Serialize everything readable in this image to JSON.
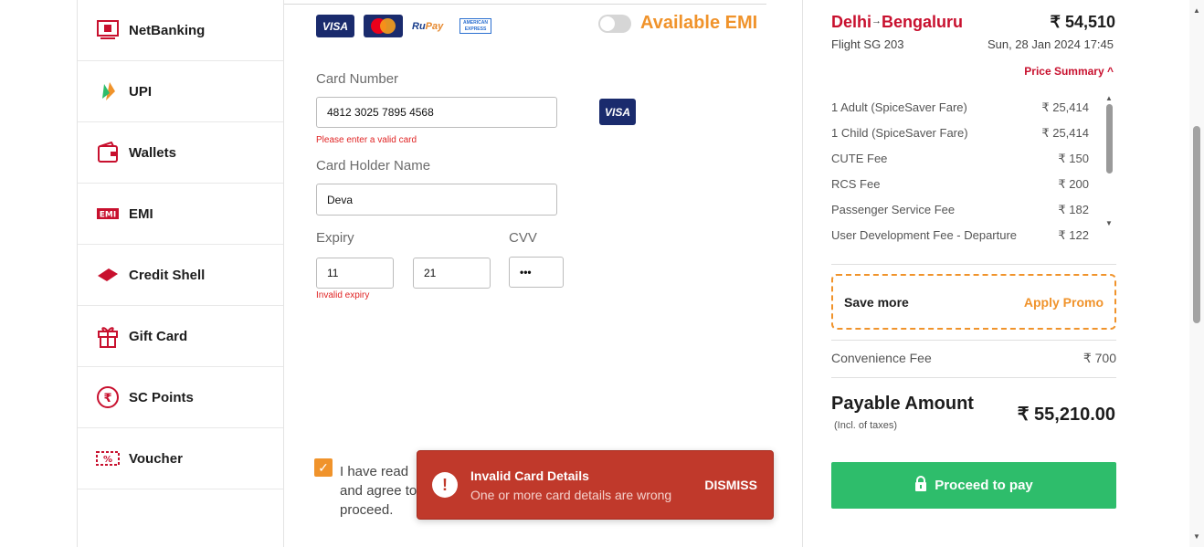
{
  "methods": [
    {
      "label": "NetBanking",
      "icon": "bank-icon"
    },
    {
      "label": "UPI",
      "icon": "upi-icon"
    },
    {
      "label": "Wallets",
      "icon": "wallet-icon"
    },
    {
      "label": "EMI",
      "icon": "emi-icon"
    },
    {
      "label": "Credit Shell",
      "icon": "credit-shell-icon"
    },
    {
      "label": "Gift Card",
      "icon": "gift-icon"
    },
    {
      "label": "SC Points",
      "icon": "rupee-icon"
    },
    {
      "label": "Voucher",
      "icon": "voucher-icon"
    }
  ],
  "card_logos": {
    "visa": "VISA",
    "mastercard": "MasterCard",
    "rupay_ru": "Ru",
    "rupay_pay": "Pay",
    "amex": "AMERICAN EXPRESS"
  },
  "emi": {
    "label": "Available EMI"
  },
  "form": {
    "card_number_label": "Card Number",
    "card_number_value": "4812 3025 7895 4568",
    "card_error": "Please enter a valid card",
    "card_brand": "VISA",
    "holder_label": "Card Holder Name",
    "holder_value": "Deva",
    "expiry_label": "Expiry",
    "expiry_month": "11",
    "expiry_year": "21",
    "expiry_error": "Invalid expiry",
    "cvv_label": "CVV",
    "cvv_value": "•••"
  },
  "agree": {
    "text": "I have read and agree to proceed.",
    "checkmark": "✓"
  },
  "toast": {
    "icon": "!",
    "title": "Invalid Card Details",
    "message": "One or more card details are wrong",
    "dismiss": "DISMISS"
  },
  "summary": {
    "from": "Delhi",
    "to": "Bengaluru",
    "arrow": "→",
    "total": "₹ 54,510",
    "flight": "Flight  SG 203",
    "date": "Sun, 28 Jan 2024 17:45",
    "price_summary": "Price Summary ^",
    "fares": [
      {
        "label": "1 Adult  (SpiceSaver Fare)",
        "value": "₹ 25,414"
      },
      {
        "label": "1 Child  (SpiceSaver Fare)",
        "value": "₹ 25,414"
      },
      {
        "label": "CUTE Fee",
        "value": "₹ 150"
      },
      {
        "label": "RCS Fee",
        "value": "₹ 200"
      },
      {
        "label": "Passenger Service Fee",
        "value": "₹ 182"
      },
      {
        "label": "User Development Fee - Departure",
        "value": "₹ 122"
      }
    ],
    "save_more": "Save more",
    "apply_promo": "Apply Promo",
    "convenience_label": "Convenience Fee",
    "convenience_value": "₹ 700",
    "payable_label": "Payable Amount",
    "incl": "(Incl. of taxes)",
    "payable_value": "₹ 55,210.00",
    "proceed": "Proceed to pay"
  },
  "colors": {
    "brand_red": "#c8102e",
    "orange": "#f0932b",
    "green": "#2ebd6b",
    "toast_red": "#c0392b"
  }
}
